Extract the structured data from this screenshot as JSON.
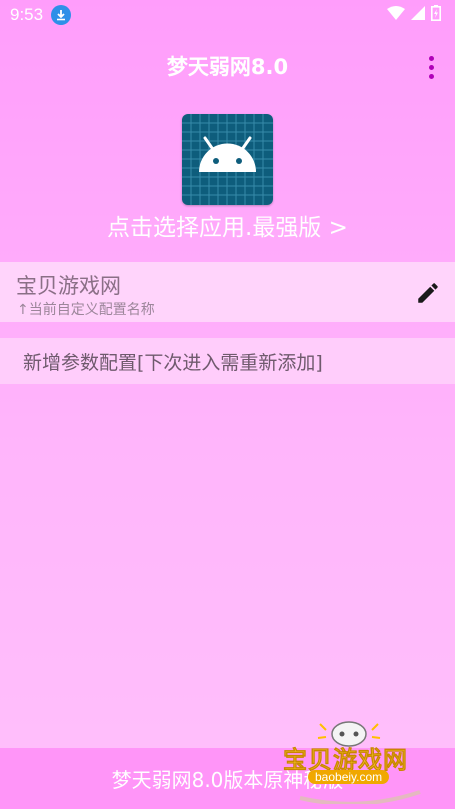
{
  "status_bar": {
    "time": "9:53"
  },
  "header": {
    "title": "梦天弱网8.0"
  },
  "app_picker": {
    "label": "点击选择应用.最强版 >"
  },
  "config": {
    "name": "宝贝游戏网",
    "hint": "↑当前自定义配置名称"
  },
  "add_config": {
    "label": "新增参数配置[下次进入需重新添加]"
  },
  "footer": {
    "text": "梦天弱网8.0版本原神秘版"
  },
  "watermark": {
    "title": "宝贝游戏网",
    "url": "baobeiy.com"
  },
  "colors": {
    "background": "#ff9dfb",
    "card": "#ffd4fb",
    "menu_dots": "#b000b8",
    "download_badge": "#2e8fe8"
  }
}
